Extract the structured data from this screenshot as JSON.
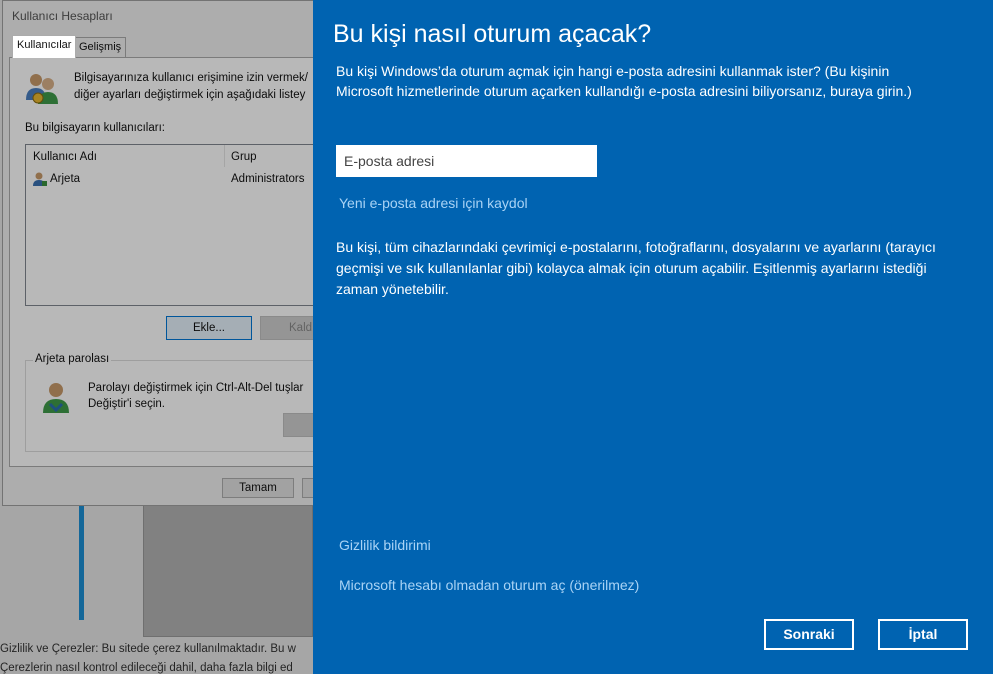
{
  "background": {
    "footer_line1": "Gizlilik ve Çerezler: Bu sitede çerez kullanılmaktadır. Bu w",
    "footer_line2": "Çerezlerin nasıl kontrol edileceği dahil, daha fazla bilgi ed"
  },
  "dialog": {
    "title": "Kullanıcı Hesapları",
    "tabs": [
      "Kullanıcılar",
      "Gelişmiş"
    ],
    "intro_line1": "Bilgisayarınıza kullanıcı erişimine izin vermek/",
    "intro_line2": "diğer ayarları değiştirmek için aşağıdaki listey",
    "list_label": "Bu bilgisayarın kullanıcıları:",
    "columns": [
      "Kullanıcı Adı",
      "Grup"
    ],
    "rows": [
      {
        "name": "Arjeta",
        "group": "Administrators"
      }
    ],
    "add_button": "Ekle...",
    "remove_button": "Kald",
    "password_group_title": "Arjeta parolası",
    "password_line1": "Parolayı değiştirmek için Ctrl-Alt-Del tuşlar",
    "password_line2": "Değiştir'i seçin.",
    "ok_button": "Tamam"
  },
  "flyout": {
    "title": "Bu kişi nasıl oturum açacak?",
    "description": "Bu kişi Windows’da oturum açmak için hangi e-posta adresini kullanmak ister? (Bu kişinin Microsoft hizmetlerinde oturum açarken kullandığı e-posta adresini biliyorsanız, buraya girin.)",
    "email_placeholder": "E-posta adresi",
    "signup_link": "Yeni e-posta adresi için kaydol",
    "info": "Bu kişi, tüm cihazlarındaki çevrimiçi e-postalarını, fotoğraflarını, dosyalarını ve ayarlarını (tarayıcı geçmişi ve sık kullanılanlar gibi) kolayca almak için oturum açabilir. Eşitlenmiş ayarlarını istediği zaman yönetebilir.",
    "privacy_link": "Gizlilik bildirimi",
    "no_account_link": "Microsoft hesabı olmadan oturum aç (önerilmez)",
    "next_button": "Sonraki",
    "cancel_button": "İptal"
  },
  "colors": {
    "flyout_bg": "#0063b1",
    "link": "#a9d3f5"
  }
}
